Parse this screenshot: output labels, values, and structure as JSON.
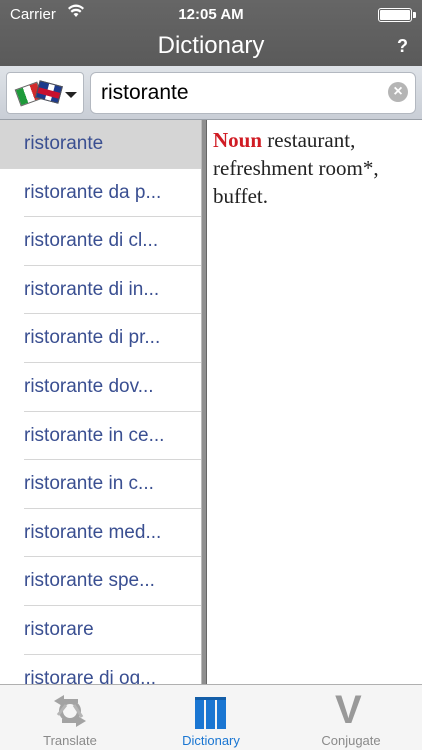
{
  "status": {
    "carrier": "Carrier",
    "time": "12:05 AM"
  },
  "nav": {
    "title": "Dictionary",
    "help": "?"
  },
  "search": {
    "value": "ristorante",
    "language_icons": [
      "italy-flag-icon",
      "uk-flag-icon"
    ]
  },
  "list": {
    "items": [
      {
        "label": "ristorante"
      },
      {
        "label": "ristorante da p..."
      },
      {
        "label": "ristorante di cl..."
      },
      {
        "label": "ristorante di in..."
      },
      {
        "label": "ristorante di pr..."
      },
      {
        "label": "ristorante dov..."
      },
      {
        "label": "ristorante in ce..."
      },
      {
        "label": "ristorante in c..."
      },
      {
        "label": "ristorante med..."
      },
      {
        "label": "ristorante spe..."
      },
      {
        "label": "ristorare"
      },
      {
        "label": "ristorare di og..."
      }
    ],
    "selected_index": 0
  },
  "definition": {
    "part_of_speech": "Noun",
    "text": " restaurant, refreshment room*, buffet."
  },
  "tabs": [
    {
      "label": "Translate",
      "icon": "translate-icon"
    },
    {
      "label": "Dictionary",
      "icon": "dictionary-icon"
    },
    {
      "label": "Conjugate",
      "icon": "conjugate-icon"
    }
  ],
  "colors": {
    "accent": "#1a76d2",
    "list_text": "#3a4f91",
    "pos_red": "#d01c24"
  }
}
